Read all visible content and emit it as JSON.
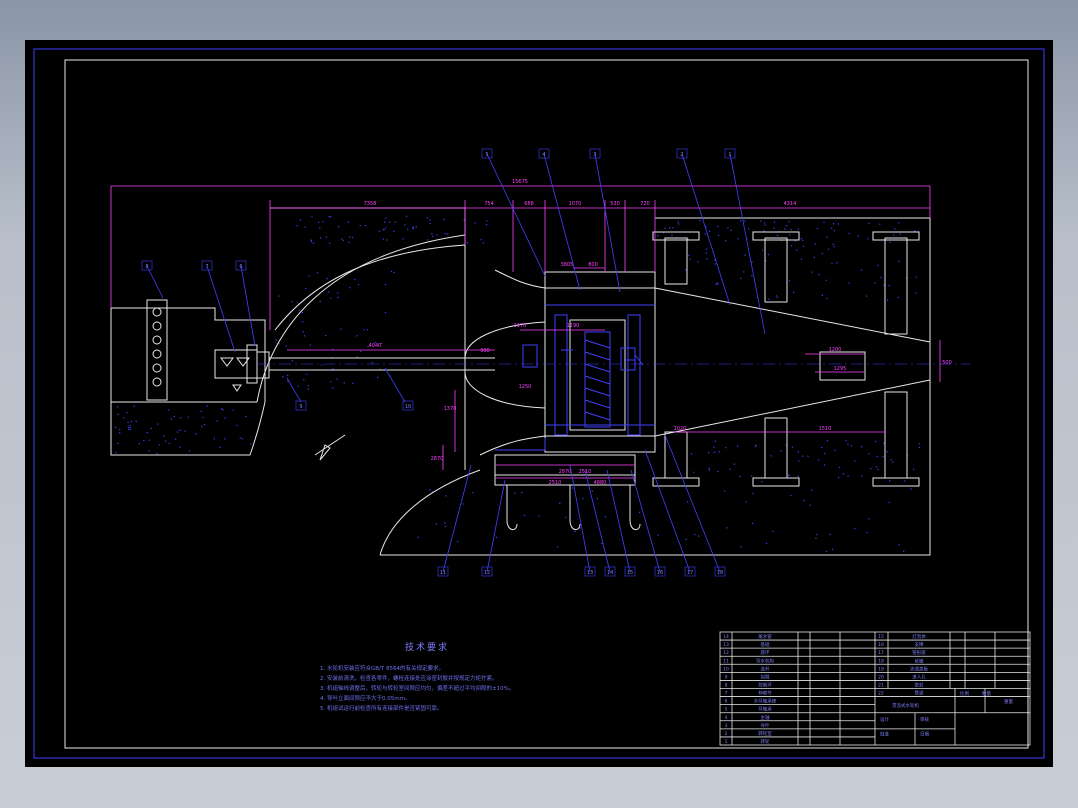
{
  "drawing": {
    "tech_notes_title": "技术要求",
    "tech_notes": [
      "1. 水轮机安装应符合GB/T 8564的有关规定要求。",
      "2. 安装前清洗，检查各零件，螺栓连接处应涂密封胶并按规定力矩拧紧。",
      "3. 机组轴线调整后，转轮与转轮室间隙应均匀，偏差不超过平均间隙的±10%。",
      "4. 导叶立面间隙应不大于0.05mm。",
      "5. 机组试运行前检查所有连接部件是否紧固可靠。"
    ],
    "dims_top": [
      "15675",
      "7358",
      "754",
      "688",
      "1070",
      "530",
      "720",
      "4314"
    ],
    "dims_inner": [
      "4040",
      "1170",
      "1190",
      "3805",
      "800",
      "1250",
      "1370",
      "2870",
      "2870",
      "2510",
      "2510",
      "4880",
      "1020",
      "1510",
      "1200",
      "1295",
      "500",
      "900"
    ],
    "part_callouts_top": [
      "5",
      "4",
      "3",
      "2",
      "1"
    ],
    "part_callouts_left": [
      "8",
      "7",
      "6"
    ],
    "part_callouts_bottom": [
      "9",
      "10",
      "11",
      "12",
      "13",
      "14",
      "15",
      "16",
      "17",
      "18"
    ],
    "title_block": {
      "drawing_name": "贯流式水轮机",
      "labels": [
        "比例",
        "数量",
        "重量",
        "设计",
        "审核",
        "批准",
        "日期"
      ]
    },
    "bom_left": [
      "转轮",
      "转轮室",
      "导叶",
      "主轴",
      "导轴承",
      "水导轴承座",
      "伸缩节",
      "控制环",
      "拐臂",
      "连杆",
      "导水机构",
      "座环",
      "基础",
      "尾水管"
    ],
    "bom_right": [
      "灯泡体",
      "支撑",
      "管形座",
      "前锥",
      "流道盖板",
      "进人孔",
      "密封",
      "管道"
    ]
  }
}
